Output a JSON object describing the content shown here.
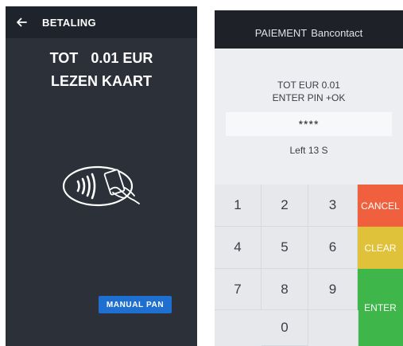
{
  "left_screen": {
    "header": {
      "title": "BETALING",
      "back_icon": "arrow-left-icon"
    },
    "amount": {
      "prefix": "TOT",
      "value": "0.01 EUR"
    },
    "instruction": "LEZEN KAART",
    "contactless_icon": "contactless-card-tap-icon",
    "manual_pan_label": "MANUAL PAN",
    "colors": {
      "background": "#2b3039",
      "header": "#1f232b",
      "button": "#1f6fd1"
    }
  },
  "right_screen": {
    "header": {
      "title_main": "PAIEMENT",
      "title_sub": "Bancontact"
    },
    "amount_line": "TOT  EUR 0.01",
    "instruction_line": "ENTER PIN  +OK",
    "pin_mask": "****",
    "timer": "Left 13 S",
    "keypad": {
      "digits": [
        "1",
        "2",
        "3",
        "4",
        "5",
        "6",
        "7",
        "8",
        "9",
        "0"
      ],
      "cancel_label": "CANCEL",
      "clear_label": "CLEAR",
      "enter_label": "ENTER"
    },
    "colors": {
      "cancel": "#f0603e",
      "clear": "#e0c13a",
      "enter": "#3fb64a",
      "header": "#1e2128"
    }
  }
}
